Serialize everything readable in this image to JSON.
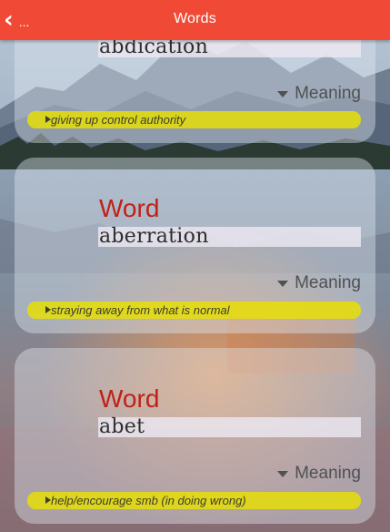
{
  "appbar": {
    "back_label": "...",
    "title": "Words"
  },
  "cards": [
    {
      "word_label": "",
      "word": "abdication",
      "meaning_toggle": "Meaning",
      "meaning": "giving up control authority"
    },
    {
      "word_label": "Word",
      "word": "aberration",
      "meaning_toggle": "Meaning",
      "meaning": "straying away from what is normal"
    },
    {
      "word_label": "Word",
      "word": "abet",
      "meaning_toggle": "Meaning",
      "meaning": "help/encourage smb (in doing wrong)"
    }
  ],
  "colors": {
    "appbar": "#f04a37",
    "word_label": "#c21f16",
    "meaning_bar": "#e8e000"
  }
}
